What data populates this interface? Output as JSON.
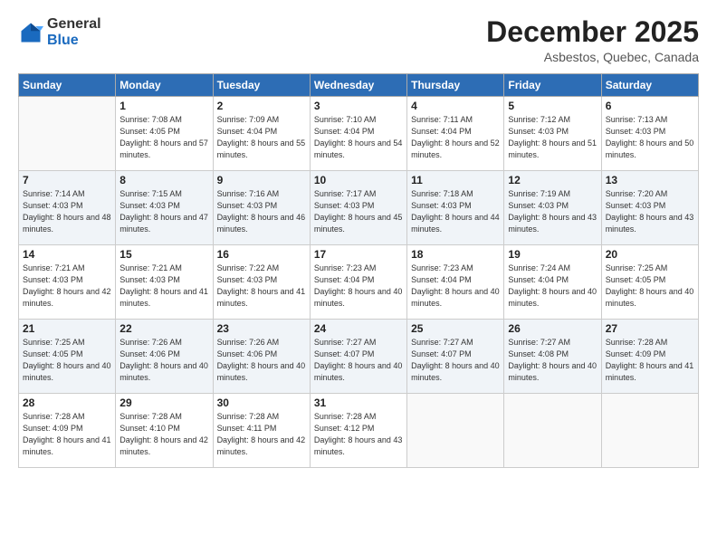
{
  "logo": {
    "general": "General",
    "blue": "Blue"
  },
  "header": {
    "month": "December 2025",
    "location": "Asbestos, Quebec, Canada"
  },
  "days_of_week": [
    "Sunday",
    "Monday",
    "Tuesday",
    "Wednesday",
    "Thursday",
    "Friday",
    "Saturday"
  ],
  "weeks": [
    [
      {
        "day": "",
        "sunrise": "",
        "sunset": "",
        "daylight": ""
      },
      {
        "day": "1",
        "sunrise": "Sunrise: 7:08 AM",
        "sunset": "Sunset: 4:05 PM",
        "daylight": "Daylight: 8 hours and 57 minutes."
      },
      {
        "day": "2",
        "sunrise": "Sunrise: 7:09 AM",
        "sunset": "Sunset: 4:04 PM",
        "daylight": "Daylight: 8 hours and 55 minutes."
      },
      {
        "day": "3",
        "sunrise": "Sunrise: 7:10 AM",
        "sunset": "Sunset: 4:04 PM",
        "daylight": "Daylight: 8 hours and 54 minutes."
      },
      {
        "day": "4",
        "sunrise": "Sunrise: 7:11 AM",
        "sunset": "Sunset: 4:04 PM",
        "daylight": "Daylight: 8 hours and 52 minutes."
      },
      {
        "day": "5",
        "sunrise": "Sunrise: 7:12 AM",
        "sunset": "Sunset: 4:03 PM",
        "daylight": "Daylight: 8 hours and 51 minutes."
      },
      {
        "day": "6",
        "sunrise": "Sunrise: 7:13 AM",
        "sunset": "Sunset: 4:03 PM",
        "daylight": "Daylight: 8 hours and 50 minutes."
      }
    ],
    [
      {
        "day": "7",
        "sunrise": "Sunrise: 7:14 AM",
        "sunset": "Sunset: 4:03 PM",
        "daylight": "Daylight: 8 hours and 48 minutes."
      },
      {
        "day": "8",
        "sunrise": "Sunrise: 7:15 AM",
        "sunset": "Sunset: 4:03 PM",
        "daylight": "Daylight: 8 hours and 47 minutes."
      },
      {
        "day": "9",
        "sunrise": "Sunrise: 7:16 AM",
        "sunset": "Sunset: 4:03 PM",
        "daylight": "Daylight: 8 hours and 46 minutes."
      },
      {
        "day": "10",
        "sunrise": "Sunrise: 7:17 AM",
        "sunset": "Sunset: 4:03 PM",
        "daylight": "Daylight: 8 hours and 45 minutes."
      },
      {
        "day": "11",
        "sunrise": "Sunrise: 7:18 AM",
        "sunset": "Sunset: 4:03 PM",
        "daylight": "Daylight: 8 hours and 44 minutes."
      },
      {
        "day": "12",
        "sunrise": "Sunrise: 7:19 AM",
        "sunset": "Sunset: 4:03 PM",
        "daylight": "Daylight: 8 hours and 43 minutes."
      },
      {
        "day": "13",
        "sunrise": "Sunrise: 7:20 AM",
        "sunset": "Sunset: 4:03 PM",
        "daylight": "Daylight: 8 hours and 43 minutes."
      }
    ],
    [
      {
        "day": "14",
        "sunrise": "Sunrise: 7:21 AM",
        "sunset": "Sunset: 4:03 PM",
        "daylight": "Daylight: 8 hours and 42 minutes."
      },
      {
        "day": "15",
        "sunrise": "Sunrise: 7:21 AM",
        "sunset": "Sunset: 4:03 PM",
        "daylight": "Daylight: 8 hours and 41 minutes."
      },
      {
        "day": "16",
        "sunrise": "Sunrise: 7:22 AM",
        "sunset": "Sunset: 4:03 PM",
        "daylight": "Daylight: 8 hours and 41 minutes."
      },
      {
        "day": "17",
        "sunrise": "Sunrise: 7:23 AM",
        "sunset": "Sunset: 4:04 PM",
        "daylight": "Daylight: 8 hours and 40 minutes."
      },
      {
        "day": "18",
        "sunrise": "Sunrise: 7:23 AM",
        "sunset": "Sunset: 4:04 PM",
        "daylight": "Daylight: 8 hours and 40 minutes."
      },
      {
        "day": "19",
        "sunrise": "Sunrise: 7:24 AM",
        "sunset": "Sunset: 4:04 PM",
        "daylight": "Daylight: 8 hours and 40 minutes."
      },
      {
        "day": "20",
        "sunrise": "Sunrise: 7:25 AM",
        "sunset": "Sunset: 4:05 PM",
        "daylight": "Daylight: 8 hours and 40 minutes."
      }
    ],
    [
      {
        "day": "21",
        "sunrise": "Sunrise: 7:25 AM",
        "sunset": "Sunset: 4:05 PM",
        "daylight": "Daylight: 8 hours and 40 minutes."
      },
      {
        "day": "22",
        "sunrise": "Sunrise: 7:26 AM",
        "sunset": "Sunset: 4:06 PM",
        "daylight": "Daylight: 8 hours and 40 minutes."
      },
      {
        "day": "23",
        "sunrise": "Sunrise: 7:26 AM",
        "sunset": "Sunset: 4:06 PM",
        "daylight": "Daylight: 8 hours and 40 minutes."
      },
      {
        "day": "24",
        "sunrise": "Sunrise: 7:27 AM",
        "sunset": "Sunset: 4:07 PM",
        "daylight": "Daylight: 8 hours and 40 minutes."
      },
      {
        "day": "25",
        "sunrise": "Sunrise: 7:27 AM",
        "sunset": "Sunset: 4:07 PM",
        "daylight": "Daylight: 8 hours and 40 minutes."
      },
      {
        "day": "26",
        "sunrise": "Sunrise: 7:27 AM",
        "sunset": "Sunset: 4:08 PM",
        "daylight": "Daylight: 8 hours and 40 minutes."
      },
      {
        "day": "27",
        "sunrise": "Sunrise: 7:28 AM",
        "sunset": "Sunset: 4:09 PM",
        "daylight": "Daylight: 8 hours and 41 minutes."
      }
    ],
    [
      {
        "day": "28",
        "sunrise": "Sunrise: 7:28 AM",
        "sunset": "Sunset: 4:09 PM",
        "daylight": "Daylight: 8 hours and 41 minutes."
      },
      {
        "day": "29",
        "sunrise": "Sunrise: 7:28 AM",
        "sunset": "Sunset: 4:10 PM",
        "daylight": "Daylight: 8 hours and 42 minutes."
      },
      {
        "day": "30",
        "sunrise": "Sunrise: 7:28 AM",
        "sunset": "Sunset: 4:11 PM",
        "daylight": "Daylight: 8 hours and 42 minutes."
      },
      {
        "day": "31",
        "sunrise": "Sunrise: 7:28 AM",
        "sunset": "Sunset: 4:12 PM",
        "daylight": "Daylight: 8 hours and 43 minutes."
      },
      {
        "day": "",
        "sunrise": "",
        "sunset": "",
        "daylight": ""
      },
      {
        "day": "",
        "sunrise": "",
        "sunset": "",
        "daylight": ""
      },
      {
        "day": "",
        "sunrise": "",
        "sunset": "",
        "daylight": ""
      }
    ]
  ]
}
